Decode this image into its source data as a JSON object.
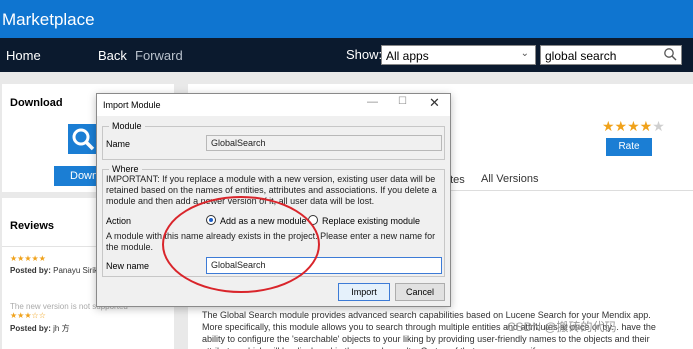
{
  "header": {
    "title": "Marketplace"
  },
  "nav": {
    "home": "Home",
    "back": "Back",
    "forward": "Forward",
    "show_label": "Show:",
    "show_value": "All apps",
    "search_value": "global search"
  },
  "sidebar": {
    "download_heading": "Download",
    "download_button": "Downl",
    "reviews_heading": "Reviews",
    "reviews": [
      {
        "stars": "★★★★★",
        "by_label": "Posted by:",
        "author": "Panayu Sirikra"
      },
      {
        "stars": "★★★☆☆",
        "note": "The new version is not supported",
        "by_label": "Posted by:",
        "author": "jh 方"
      }
    ]
  },
  "main": {
    "rating": {
      "filled": "★★★★",
      "empty": "★"
    },
    "rate_button": "Rate",
    "tabs": [
      "otes",
      "All Versions"
    ],
    "description": "The Global Search module provides advanced search capabilities based on Lucene Search for your Mendix app. More specifically, this module allows you to search through multiple entities and attributes at once or by... have the ability to configure the 'searchable' objects to your liking by providing user-friendly names to the objects and their attributes which will be displayed in the search results. On top of that you can specify an ..."
  },
  "watermark": "CSDN @搬砖的代码",
  "dialog": {
    "title": "Import Module",
    "module_legend": "Module",
    "name_label": "Name",
    "name_value": "GlobalSearch",
    "where_legend": "Where",
    "important_text": "IMPORTANT: If you replace a module with a new version, existing user data will be retained based on the names of entities, attributes and associations. If you delete a module and then add a newer version of it, all user data will be lost.",
    "action_label": "Action",
    "action_options": [
      "Add as a new module",
      "Replace existing module"
    ],
    "exists_message": "A module with this name already exists in the project. Please enter a new name for the module.",
    "new_name_label": "New name",
    "new_name_value": "GlobalSearch",
    "import_button": "Import",
    "cancel_button": "Cancel"
  },
  "colors": {
    "header_blue": "#0f75d0",
    "navbar": "#0b1a2e",
    "accent_blue": "#1b7ed4",
    "star": "#f0a21b",
    "annotation": "#d9252b"
  }
}
